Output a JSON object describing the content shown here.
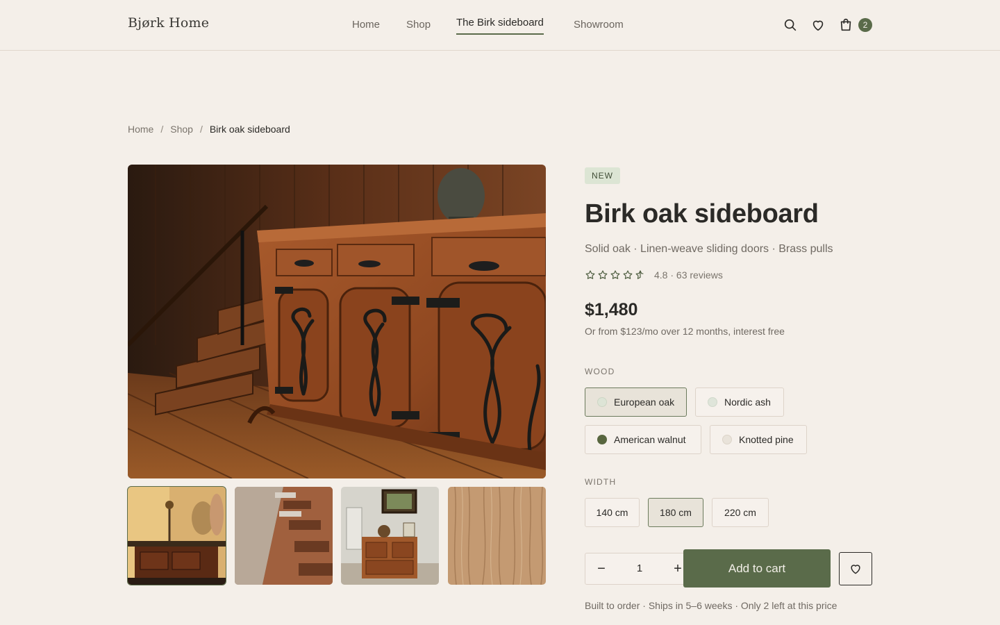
{
  "header": {
    "logo": "Bjørk Home",
    "nav": [
      {
        "label": "Home"
      },
      {
        "label": "Shop"
      },
      {
        "label": "The Birk sideboard"
      },
      {
        "label": "Showroom"
      }
    ],
    "active_nav": "The Birk sideboard",
    "cart_count": "2",
    "icons": [
      "search-icon",
      "heart-icon",
      "cart-icon"
    ]
  },
  "breadcrumb": {
    "items": [
      "Home",
      "Shop"
    ],
    "current": "Birk oak sideboard",
    "separator": "/"
  },
  "gallery": {
    "thumbnail_count": 4,
    "selected_index": 0
  },
  "product": {
    "badge": "NEW",
    "title": "Birk oak sideboard",
    "subtitle": "Solid oak · Linen-weave sliding doors · Brass pulls",
    "rating": 4.8,
    "rating_text": "4.8 · 63 reviews",
    "price": "$1,480",
    "finance": "Or from $123/mo over 12 months, interest free"
  },
  "wood": {
    "label": "WOOD",
    "options": [
      {
        "label": "European oak",
        "color": "#dde4d6",
        "selected": true
      },
      {
        "label": "Nordic ash",
        "color": "#dfe5da",
        "selected": false
      },
      {
        "label": "American walnut",
        "color": "#58663f",
        "selected": false
      },
      {
        "label": "Knotted pine",
        "color": "#e9e3da",
        "selected": false
      }
    ]
  },
  "width": {
    "label": "WIDTH",
    "options": [
      {
        "label": "140 cm",
        "selected": false
      },
      {
        "label": "180 cm",
        "selected": true
      },
      {
        "label": "220 cm",
        "selected": false
      }
    ]
  },
  "purchase": {
    "quantity": "1",
    "minus": "−",
    "plus": "+",
    "add_to_cart": "Add to cart",
    "note": "Built to order · Ships in 5–6 weeks · Only 2 left at this price"
  },
  "colors": {
    "accent": "#5a6b4a",
    "background": "#f4efe9"
  }
}
